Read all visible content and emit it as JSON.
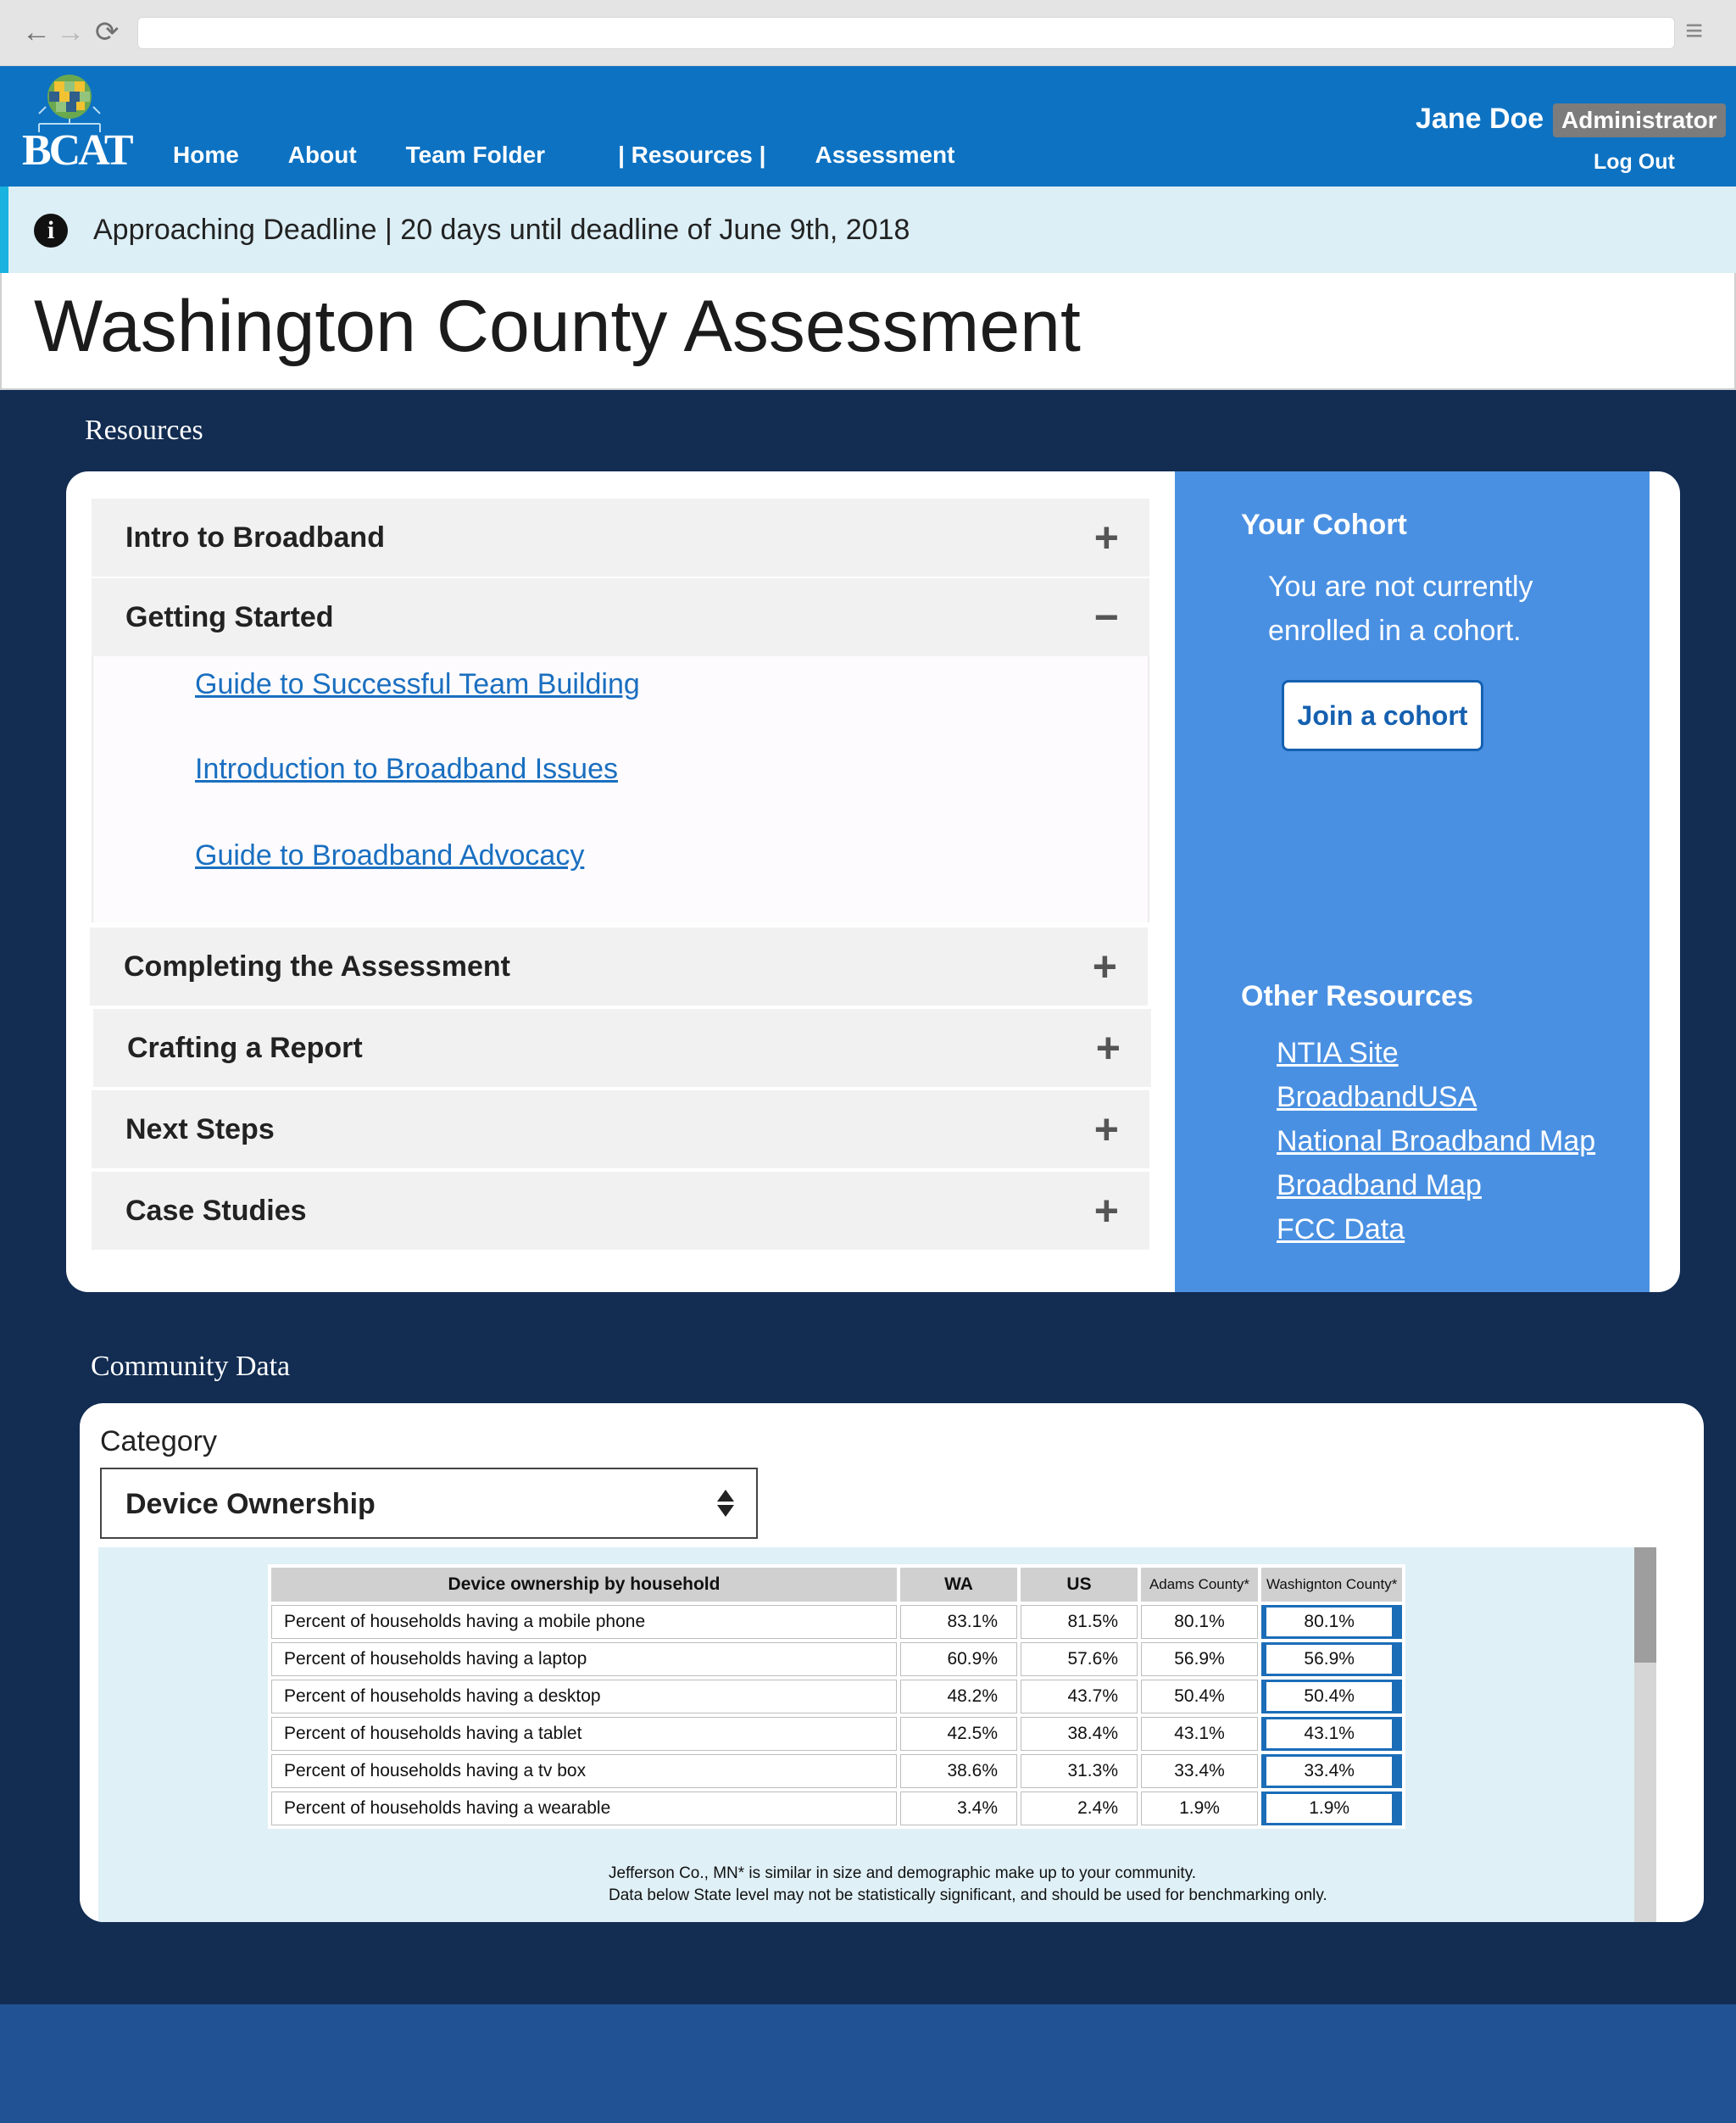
{
  "browser": {
    "back": "←",
    "forward": "→",
    "reload": "⟳",
    "menu": "≡"
  },
  "header": {
    "logo_text": "BCAT",
    "nav": [
      {
        "label": "Home"
      },
      {
        "label": "About"
      },
      {
        "label": "Team Folder"
      },
      {
        "label": "| Resources |"
      },
      {
        "label": "Assessment"
      }
    ],
    "user_name": "Jane Doe",
    "role": "Administrator",
    "logout": "Log Out"
  },
  "alert": {
    "icon": "info-icon",
    "text": "Approaching Deadline | 20 days until deadline of June 9th, 2018"
  },
  "page_title": "Washington County Assessment",
  "resources": {
    "heading": "Resources",
    "sections": [
      {
        "label": "Intro to Broadband",
        "toggle": "+",
        "expanded": false
      },
      {
        "label": "Getting Started",
        "toggle": "−",
        "expanded": true,
        "links": [
          "Guide to Successful Team Building",
          "Introduction to Broadband Issues",
          "Guide to Broadband Advocacy"
        ]
      },
      {
        "label": "Completing the Assessment",
        "toggle": "+",
        "expanded": false
      },
      {
        "label": "Crafting a Report",
        "toggle": "+",
        "expanded": false
      },
      {
        "label": "Next Steps",
        "toggle": "+",
        "expanded": false
      },
      {
        "label": "Case Studies",
        "toggle": "+",
        "expanded": false
      }
    ]
  },
  "cohort": {
    "heading": "Your Cohort",
    "text": "You are not currently enrolled in a cohort.",
    "button": "Join a cohort"
  },
  "other_resources": {
    "heading": "Other Resources",
    "links": [
      "NTIA Site",
      "BroadbandUSA",
      "National Broadband Map",
      "Broadband Map",
      "FCC Data"
    ]
  },
  "community_data": {
    "heading": "Community Data",
    "category_label": "Category",
    "category_value": "Device Ownership",
    "table": {
      "headers": [
        "Device ownership by household",
        "WA",
        "US",
        "Adams  County*",
        "Washignton County*"
      ],
      "rows": [
        [
          "Percent of households having a mobile phone",
          "83.1%",
          "81.5%",
          "80.1%",
          "80.1%"
        ],
        [
          "Percent of households having a laptop",
          "60.9%",
          "57.6%",
          "56.9%",
          "56.9%"
        ],
        [
          "Percent of households having a desktop",
          "48.2%",
          "43.7%",
          "50.4%",
          "50.4%"
        ],
        [
          "Percent of households having a tablet",
          "42.5%",
          "38.4%",
          "43.1%",
          "43.1%"
        ],
        [
          "Percent of households having a tv box",
          "38.6%",
          "31.3%",
          "33.4%",
          "33.4%"
        ],
        [
          "Percent of households having a wearable",
          "3.4%",
          "2.4%",
          "1.9%",
          "1.9%"
        ]
      ]
    },
    "notes": [
      "Jefferson Co., MN* is  similar in size and demographic make up to your community.",
      "Data below State level may not be statistically significant, and should be used for benchmarking only."
    ]
  },
  "colors": {
    "header_blue": "#0d72c2",
    "navy_background": "#122c52",
    "cohort_blue": "#4a90e2",
    "link_blue": "#1a6fc0",
    "alert_accent": "#1ab3e0"
  }
}
